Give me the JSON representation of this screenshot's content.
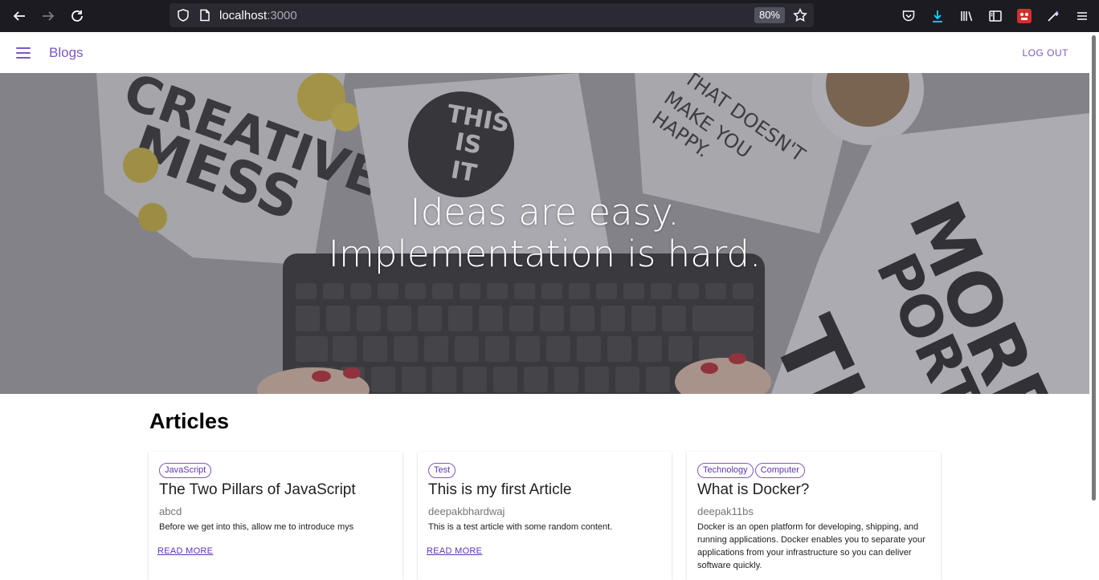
{
  "browser": {
    "url_host": "localhost",
    "url_port": ":3000",
    "zoom": "80%"
  },
  "appbar": {
    "title": "Blogs",
    "logout_label": "LOG OUT"
  },
  "hero": {
    "line1": "Ideas are easy.",
    "line2": "Implementation is hard."
  },
  "articles": {
    "heading": "Articles",
    "read_more_label": "READ MORE",
    "items": [
      {
        "tags": [
          "JavaScript"
        ],
        "title": "The Two Pillars of JavaScript",
        "author": "abcd",
        "description": "Before we get into this, allow me to introduce mys"
      },
      {
        "tags": [
          "Test"
        ],
        "title": "This is my first Article",
        "author": "deepakbhardwaj",
        "description": "This is a test article with some random content."
      },
      {
        "tags": [
          "Technology",
          "Computer"
        ],
        "title": "What is Docker?",
        "author": "deepak11bs",
        "description": "Docker is an open platform for developing, shipping, and running applications. Docker enables you to separate your applications from your infrastructure so you can deliver software quickly."
      }
    ]
  },
  "colors": {
    "accent": "#7e57c2",
    "chrome_bg": "#1c1b22"
  },
  "icons": {
    "back": "arrow-left-icon",
    "forward": "arrow-right-icon",
    "reload": "reload-icon",
    "menu": "hamburger-menu-icon"
  }
}
